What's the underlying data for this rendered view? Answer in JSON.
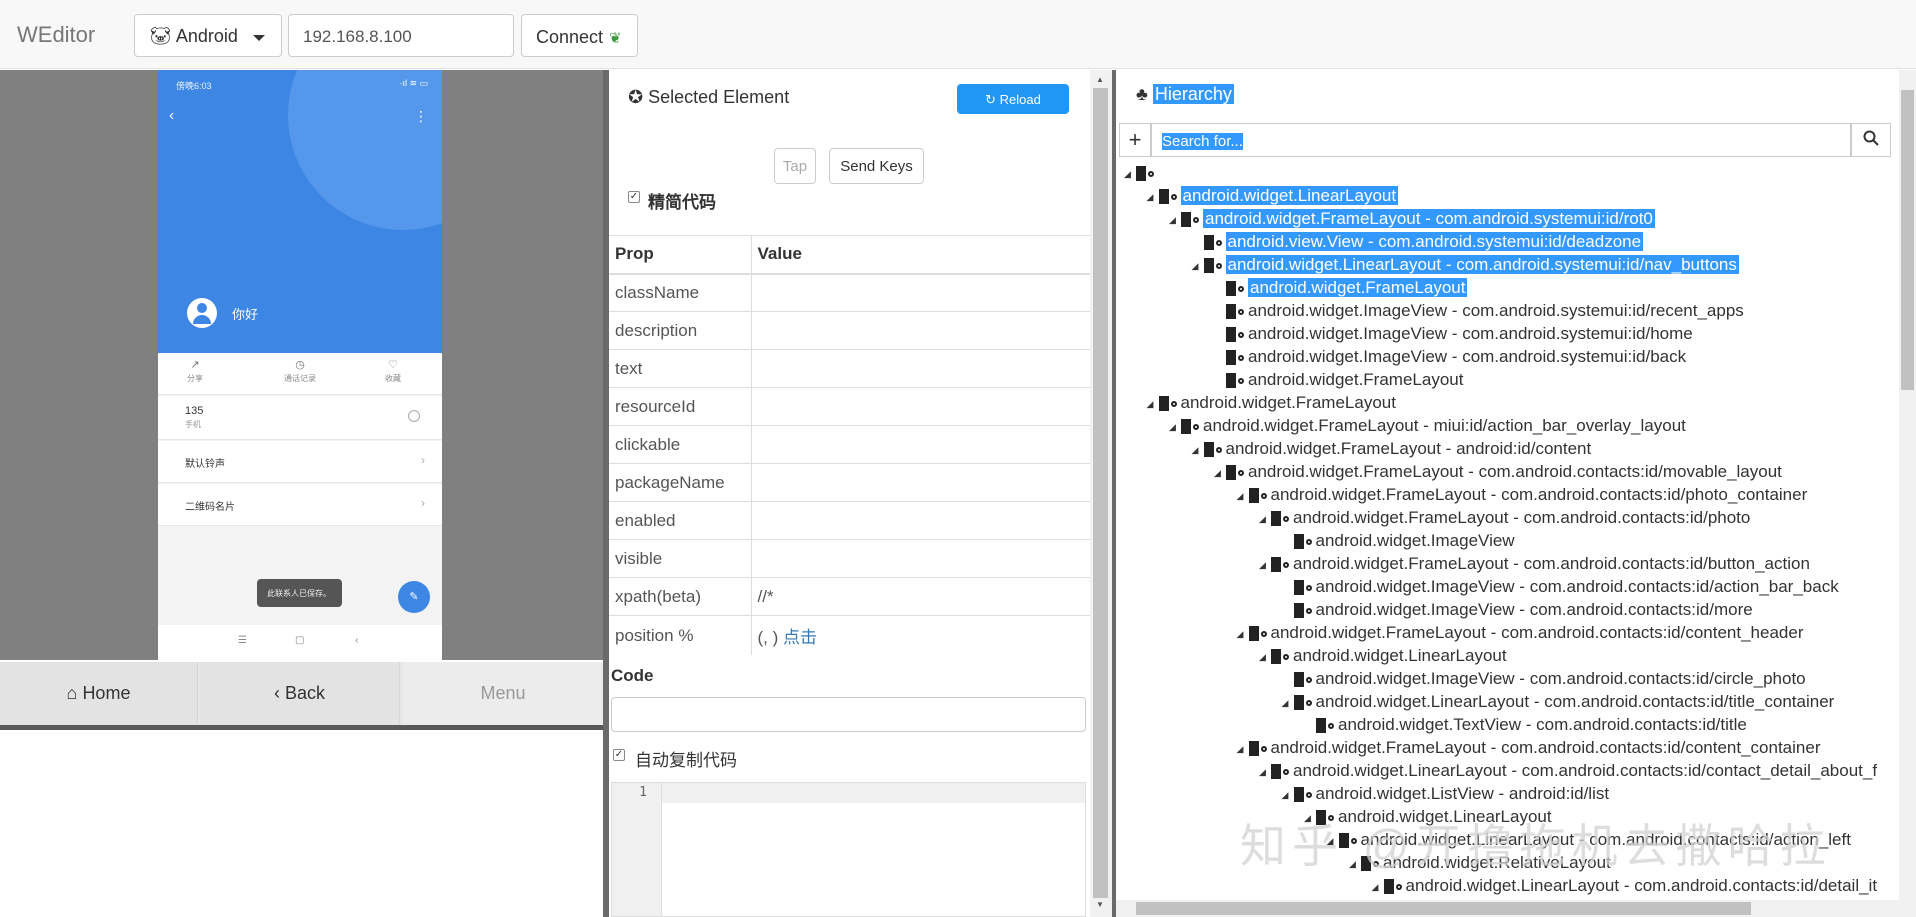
{
  "topbar": {
    "brand": "WEditor",
    "platform": "Android",
    "ip": "192.168.8.100",
    "connect": "Connect"
  },
  "phone": {
    "status_time": "傍晚6:03",
    "status_icons": "·ıl ≋ ▭",
    "name": "你好",
    "actions": [
      {
        "icon": "↗",
        "label": "分享"
      },
      {
        "icon": "◷",
        "label": "通话记录"
      },
      {
        "icon": "♡",
        "label": "收藏"
      }
    ],
    "number": "135",
    "number_sub": "手机",
    "rows": [
      "默认铃声",
      "二维码名片"
    ],
    "toast": "此联系人已保存。",
    "fab": "✎",
    "nav": [
      "☰",
      "▢",
      "‹"
    ]
  },
  "device_buttons": {
    "home": "Home",
    "back": "Back",
    "menu": "Menu"
  },
  "inspector": {
    "title": "Selected Element",
    "reload": "Reload",
    "tap": "Tap",
    "send_keys": "Send Keys",
    "simplify_label": "精简代码",
    "columns": [
      "Prop",
      "Value"
    ],
    "props": [
      {
        "prop": "className",
        "value": ""
      },
      {
        "prop": "description",
        "value": ""
      },
      {
        "prop": "text",
        "value": ""
      },
      {
        "prop": "resourceId",
        "value": ""
      },
      {
        "prop": "clickable",
        "value": ""
      },
      {
        "prop": "packageName",
        "value": ""
      },
      {
        "prop": "enabled",
        "value": ""
      },
      {
        "prop": "visible",
        "value": ""
      },
      {
        "prop": "xpath(beta)",
        "value": "//*"
      },
      {
        "prop": "position %",
        "value": "(, )",
        "link": "点击"
      }
    ],
    "code_label": "Code",
    "autocopy_label": "自动复制代码",
    "line_number": "1"
  },
  "hierarchy": {
    "title": "Hierarchy",
    "search_placeholder": "Search for...",
    "nodes": [
      {
        "label": "",
        "depth": 0,
        "selected": false,
        "toggle": "◢"
      },
      {
        "label": "android.widget.LinearLayout",
        "depth": 1,
        "selected": true,
        "toggle": "◢"
      },
      {
        "label": "android.widget.FrameLayout - com.android.systemui:id/rot0",
        "depth": 2,
        "selected": true,
        "toggle": "◢"
      },
      {
        "label": "android.view.View - com.android.systemui:id/deadzone",
        "depth": 3,
        "selected": true,
        "toggle": ""
      },
      {
        "label": "android.widget.LinearLayout - com.android.systemui:id/nav_buttons",
        "depth": 3,
        "selected": true,
        "toggle": "◢"
      },
      {
        "label": "android.widget.FrameLayout",
        "depth": 4,
        "selected": true,
        "toggle": ""
      },
      {
        "label": "android.widget.ImageView - com.android.systemui:id/recent_apps",
        "depth": 4,
        "selected": false,
        "toggle": ""
      },
      {
        "label": "android.widget.ImageView - com.android.systemui:id/home",
        "depth": 4,
        "selected": false,
        "toggle": ""
      },
      {
        "label": "android.widget.ImageView - com.android.systemui:id/back",
        "depth": 4,
        "selected": false,
        "toggle": ""
      },
      {
        "label": "android.widget.FrameLayout",
        "depth": 4,
        "selected": false,
        "toggle": ""
      },
      {
        "label": "android.widget.FrameLayout",
        "depth": 1,
        "selected": false,
        "toggle": "◢"
      },
      {
        "label": "android.widget.FrameLayout - miui:id/action_bar_overlay_layout",
        "depth": 2,
        "selected": false,
        "toggle": "◢"
      },
      {
        "label": "android.widget.FrameLayout - android:id/content",
        "depth": 3,
        "selected": false,
        "toggle": "◢"
      },
      {
        "label": "android.widget.FrameLayout - com.android.contacts:id/movable_layout",
        "depth": 4,
        "selected": false,
        "toggle": "◢"
      },
      {
        "label": "android.widget.FrameLayout - com.android.contacts:id/photo_container",
        "depth": 5,
        "selected": false,
        "toggle": "◢"
      },
      {
        "label": "android.widget.FrameLayout - com.android.contacts:id/photo",
        "depth": 6,
        "selected": false,
        "toggle": "◢"
      },
      {
        "label": "android.widget.ImageView",
        "depth": 7,
        "selected": false,
        "toggle": ""
      },
      {
        "label": "android.widget.FrameLayout - com.android.contacts:id/button_action",
        "depth": 6,
        "selected": false,
        "toggle": "◢"
      },
      {
        "label": "android.widget.ImageView - com.android.contacts:id/action_bar_back",
        "depth": 7,
        "selected": false,
        "toggle": ""
      },
      {
        "label": "android.widget.ImageView - com.android.contacts:id/more",
        "depth": 7,
        "selected": false,
        "toggle": ""
      },
      {
        "label": "android.widget.FrameLayout - com.android.contacts:id/content_header",
        "depth": 5,
        "selected": false,
        "toggle": "◢"
      },
      {
        "label": "android.widget.LinearLayout",
        "depth": 6,
        "selected": false,
        "toggle": "◢"
      },
      {
        "label": "android.widget.ImageView - com.android.contacts:id/circle_photo",
        "depth": 7,
        "selected": false,
        "toggle": ""
      },
      {
        "label": "android.widget.LinearLayout - com.android.contacts:id/title_container",
        "depth": 7,
        "selected": false,
        "toggle": "◢"
      },
      {
        "label": "android.widget.TextView - com.android.contacts:id/title",
        "depth": 8,
        "selected": false,
        "toggle": ""
      },
      {
        "label": "android.widget.FrameLayout - com.android.contacts:id/content_container",
        "depth": 5,
        "selected": false,
        "toggle": "◢"
      },
      {
        "label": "android.widget.LinearLayout - com.android.contacts:id/contact_detail_about_f",
        "depth": 6,
        "selected": false,
        "toggle": "◢"
      },
      {
        "label": "android.widget.ListView - android:id/list",
        "depth": 7,
        "selected": false,
        "toggle": "◢"
      },
      {
        "label": "android.widget.LinearLayout",
        "depth": 8,
        "selected": false,
        "toggle": "◢"
      },
      {
        "label": "android.widget.LinearLayout - com.android.contacts:id/action_left",
        "depth": 9,
        "selected": false,
        "toggle": "◢"
      },
      {
        "label": "android.widget.RelativeLayout",
        "depth": 10,
        "selected": false,
        "toggle": "◢"
      },
      {
        "label": "android.widget.LinearLayout - com.android.contacts:id/detail_it",
        "depth": 11,
        "selected": false,
        "toggle": "◢"
      }
    ]
  },
  "watermark": "知乎 @开撸拖机去撒哈拉"
}
